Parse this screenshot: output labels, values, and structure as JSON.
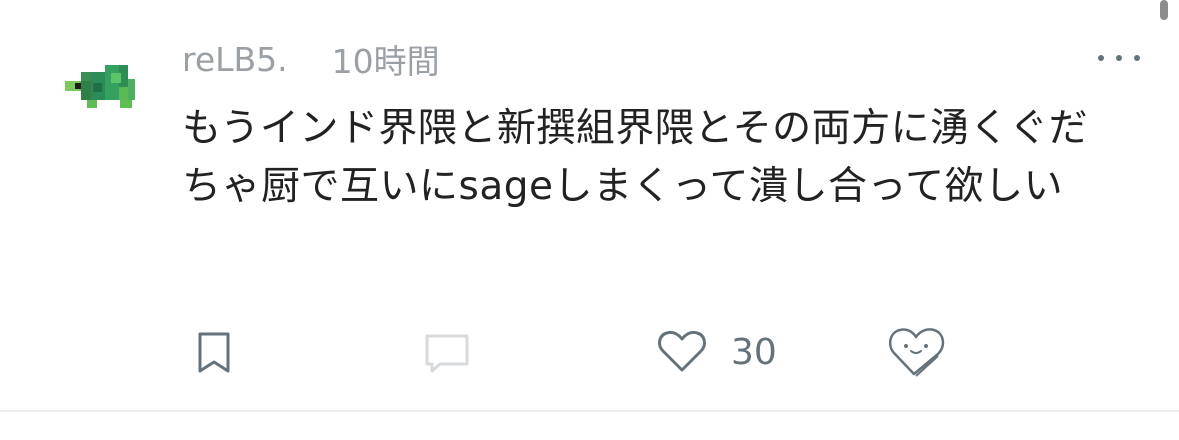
{
  "comment": {
    "username": "reLB5.",
    "timestamp": "10時間",
    "text": "もうインド界隈と新撰組界隈とその両方に湧くぐだちゃ厨で互いにsageしまくって潰し合って欲しい",
    "like_count": "30"
  },
  "icons": {
    "avatar": "pixel-turtle-avatar",
    "more": "more-horizontal-icon",
    "bookmark": "bookmark-icon",
    "reply": "comment-bubble-icon",
    "like": "heart-outline-icon",
    "reaction": "smiling-heart-icon"
  },
  "colors": {
    "meta_text": "#9aa0a6",
    "body_text": "#222222",
    "icon": "#66727a",
    "disabled_icon": "#d6dadd",
    "avatar_green": "#2d8b57"
  }
}
